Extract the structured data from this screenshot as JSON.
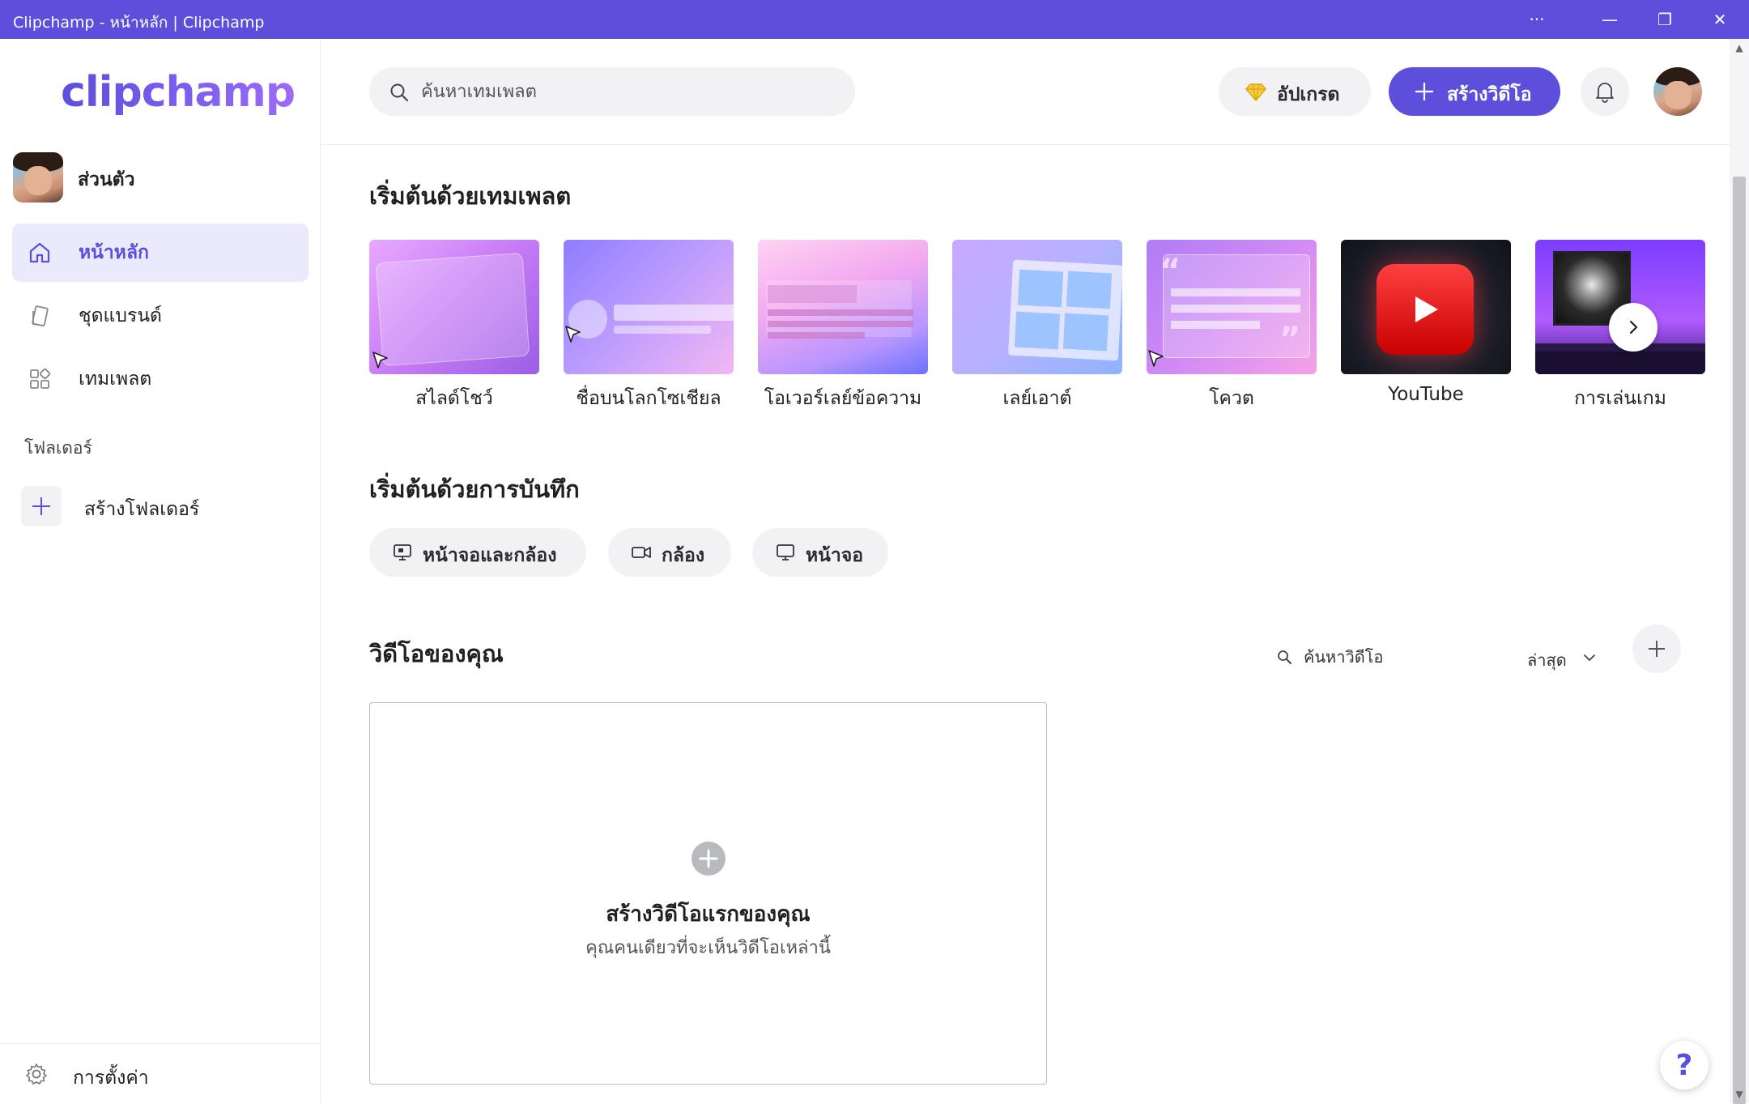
{
  "window": {
    "title": "Clipchamp - หน้าหลัก | Clipchamp",
    "more_label": "···",
    "minimize_label": "—",
    "restore_label": "❐",
    "close_label": "✕"
  },
  "sidebar": {
    "logo_text": "clipchamp",
    "profile_name": "ส่วนตัว",
    "items": [
      {
        "label": "หน้าหลัก",
        "icon": "home-icon",
        "active": true
      },
      {
        "label": "ชุดแบรนด์",
        "icon": "brand-kit-icon",
        "active": false
      },
      {
        "label": "เทมเพลต",
        "icon": "templates-icon",
        "active": false
      }
    ],
    "folders_label": "โฟลเดอร์",
    "create_folder_label": "สร้างโฟลเดอร์",
    "settings_label": "การตั้งค่า"
  },
  "header": {
    "search_placeholder": "ค้นหาเทมเพลต",
    "upgrade_label": "อัปเกรด",
    "create_video_label": "สร้างวิดีโอ"
  },
  "templates": {
    "heading": "เริ่มต้นด้วยเทมเพลต",
    "cards": [
      {
        "label": "สไลด์โชว์"
      },
      {
        "label": "ชื่อบนโลกโซเชียล"
      },
      {
        "label": "โอเวอร์เลย์ข้อความ"
      },
      {
        "label": "เลย์เอาต์"
      },
      {
        "label": "โควต"
      },
      {
        "label": "YouTube"
      },
      {
        "label": "การเล่นเกม"
      }
    ]
  },
  "recording": {
    "heading": "เริ่มต้นด้วยการบันทึก",
    "options": [
      {
        "label": "หน้าจอและกล้อง",
        "icon": "screen-camera-icon"
      },
      {
        "label": "กล้อง",
        "icon": "camera-icon"
      },
      {
        "label": "หน้าจอ",
        "icon": "screen-icon"
      }
    ]
  },
  "videos": {
    "heading": "วิดีโอของคุณ",
    "search_placeholder": "ค้นหาวิดีโอ",
    "sort_label": "ล่าสุด",
    "empty_title": "สร้างวิดีโอแรกของคุณ",
    "empty_subtitle": "คุณคนเดียวที่จะเห็นวิดีโอเหล่านี้"
  },
  "help_label": "?",
  "colors": {
    "accent": "#5b4fdb",
    "active_bg": "#ebe9fc",
    "pill_bg": "#f2f2f5"
  }
}
